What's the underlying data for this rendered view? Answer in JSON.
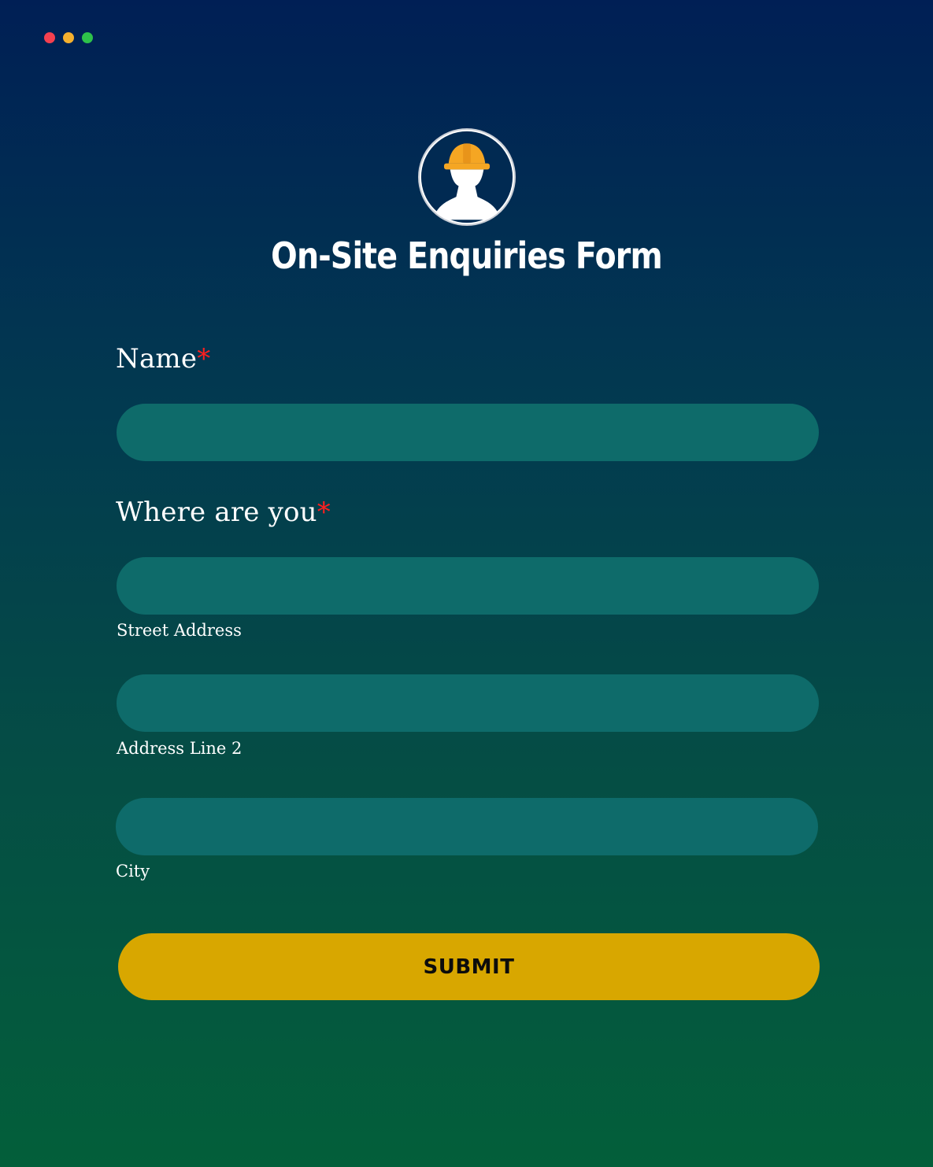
{
  "window": {
    "controls": [
      "close",
      "minimize",
      "maximize"
    ]
  },
  "header": {
    "logo_icon": "construction-worker-hardhat-icon",
    "title": "On-Site Enquiries Form"
  },
  "form": {
    "name": {
      "label": "Name",
      "required_mark": "*",
      "value": ""
    },
    "location": {
      "label": "Where are you",
      "required_mark": "*",
      "street": {
        "sublabel": "Street Address",
        "value": ""
      },
      "line2": {
        "sublabel": "Address Line 2",
        "value": ""
      },
      "city": {
        "sublabel": "City",
        "value": ""
      }
    },
    "submit_label": "SUBMIT"
  },
  "colors": {
    "background_top": "#001f55",
    "background_bottom": "#035f3a",
    "field_fill": "#0e6b6a",
    "submit_fill": "#d8a700",
    "required_mark": "#ff1f1f",
    "hardhat": "#f5a623"
  }
}
